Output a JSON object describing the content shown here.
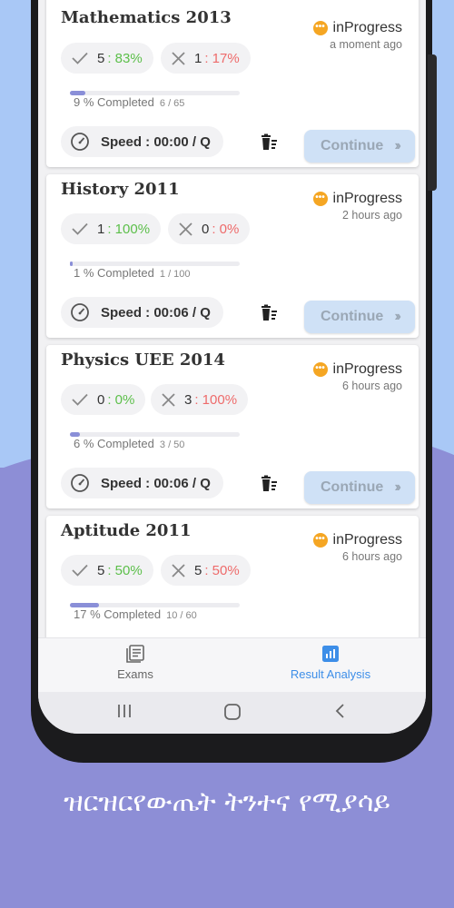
{
  "cards": [
    {
      "title": "Mathematics 2013",
      "status": "inProgress",
      "time": "a moment ago",
      "correct": "5",
      "correct_pct": ": 83%",
      "wrong": "1",
      "wrong_pct": ": 17%",
      "progress_text": "9 % Completed",
      "progress_count": "6 / 65",
      "progress_fraction": 0.09,
      "speed": "Speed : 00:00 / Q",
      "button": "Continue"
    },
    {
      "title": "History 2011",
      "status": "inProgress",
      "time": "2 hours ago",
      "correct": "1",
      "correct_pct": ": 100%",
      "wrong": "0",
      "wrong_pct": ": 0%",
      "progress_text": "1 % Completed",
      "progress_count": "1 / 100",
      "progress_fraction": 0.01,
      "speed": "Speed : 00:06 / Q",
      "button": "Continue"
    },
    {
      "title": "Physics  UEE 2014",
      "status": "inProgress",
      "time": "6 hours ago",
      "correct": "0",
      "correct_pct": ": 0%",
      "wrong": "3",
      "wrong_pct": ": 100%",
      "progress_text": "6 % Completed",
      "progress_count": "3 / 50",
      "progress_fraction": 0.06,
      "speed": "Speed : 00:06 / Q",
      "button": "Continue"
    },
    {
      "title": "Aptitude 2011",
      "status": "inProgress",
      "time": "6 hours ago",
      "correct": "5",
      "correct_pct": ": 50%",
      "wrong": "5",
      "wrong_pct": ": 50%",
      "progress_text": "17 % Completed",
      "progress_count": "10 / 60",
      "progress_fraction": 0.17
    }
  ],
  "nav": {
    "exams": "Exams",
    "result": "Result Analysis"
  },
  "caption": "ዝርዝርየውጤት ትንተና የሚያሳይ",
  "colors": {
    "accent": "#3d8ee8",
    "correct": "#5cbf4a",
    "wrong": "#ee6b6b",
    "progress": "#8a8fd8",
    "status": "#f5a623"
  }
}
